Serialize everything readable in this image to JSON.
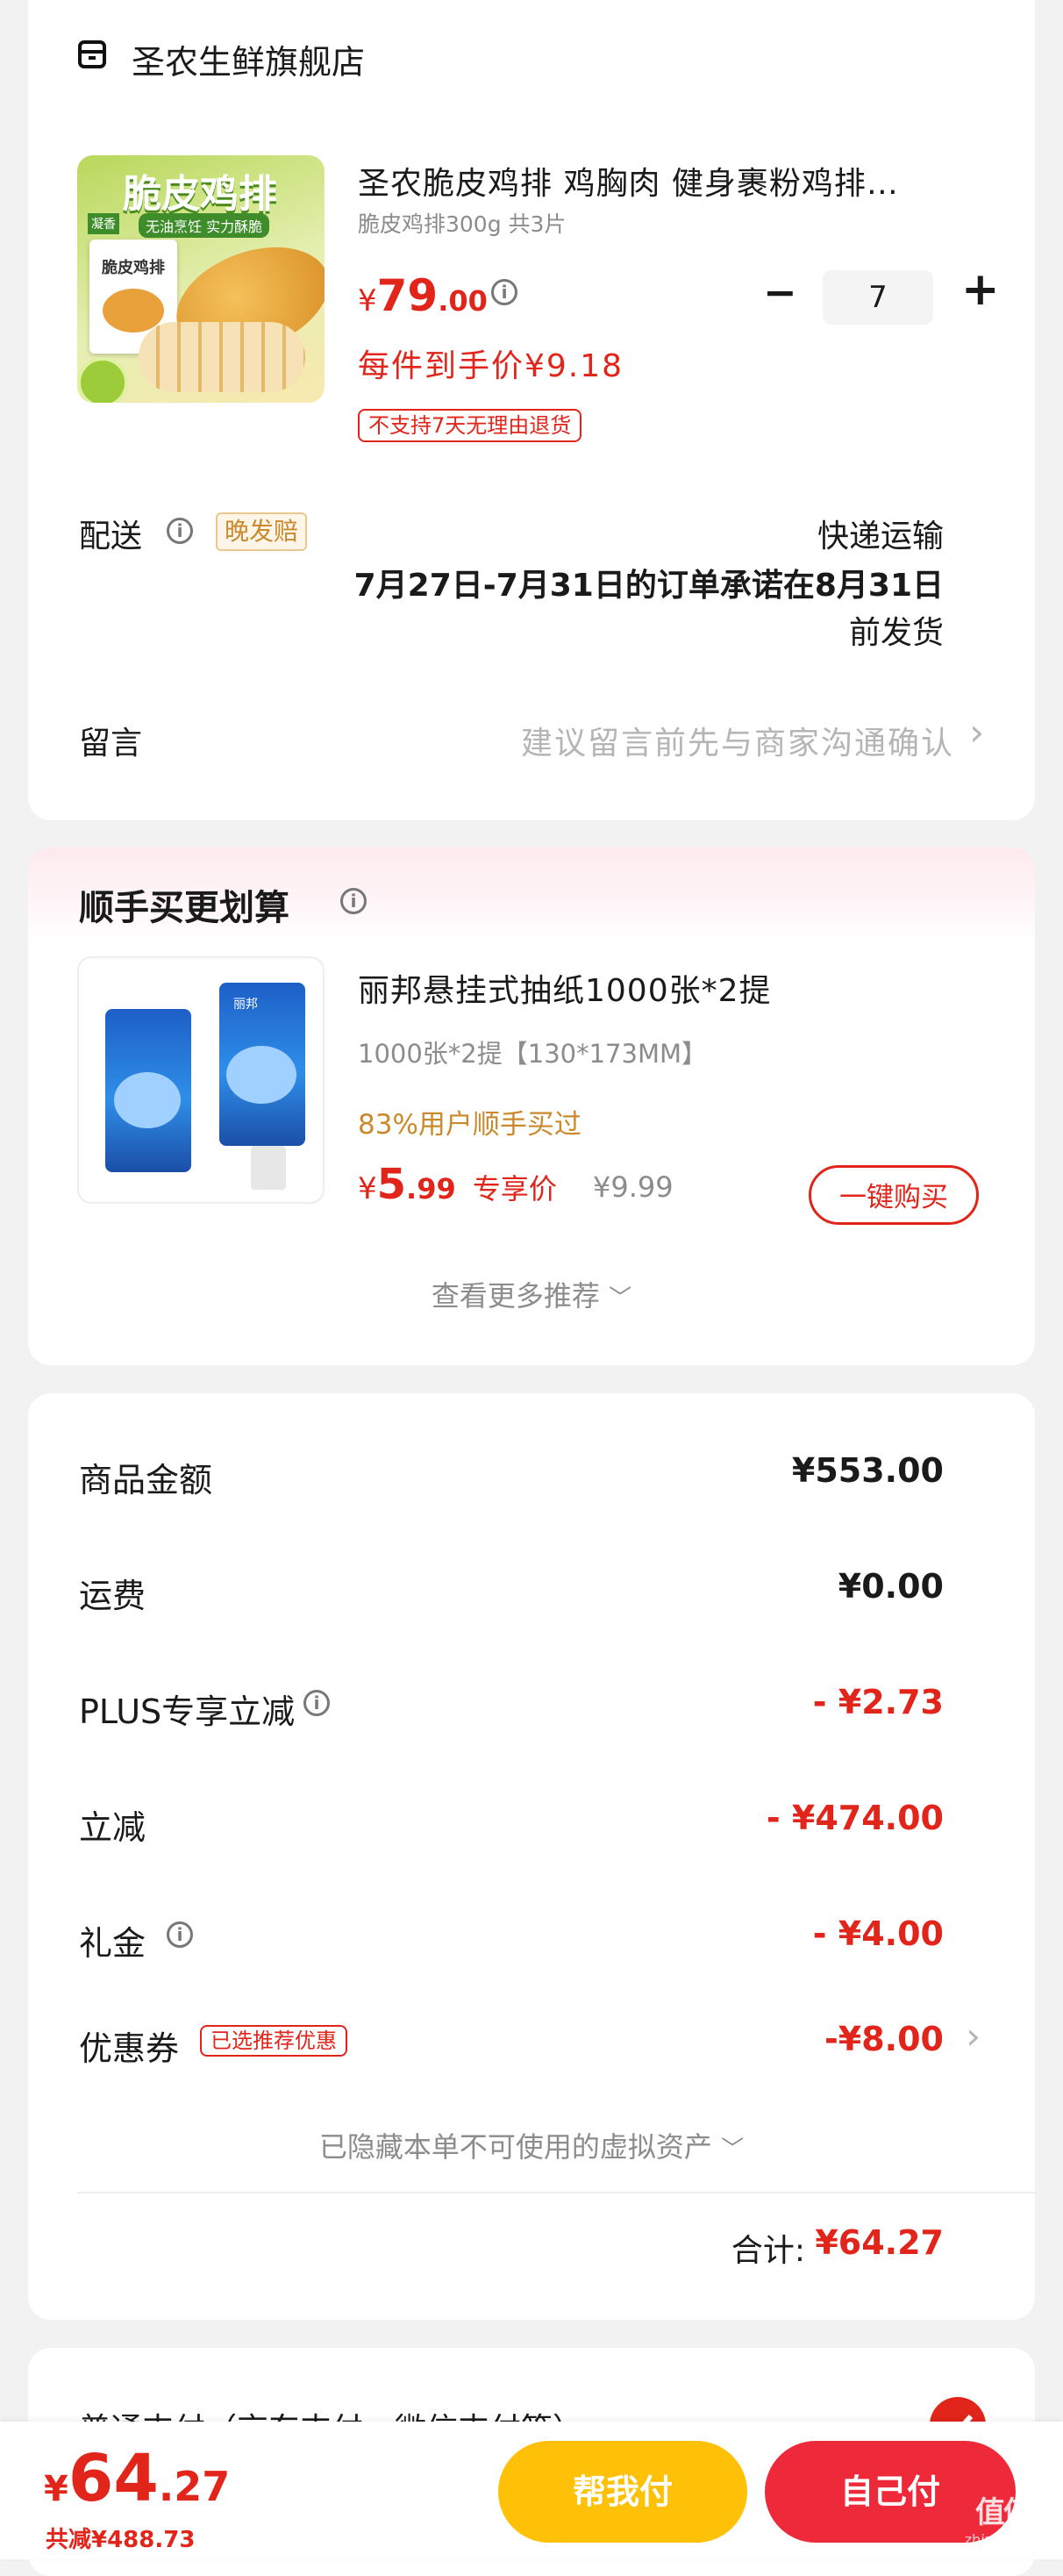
{
  "shop": {
    "icon": "store-icon",
    "name": "圣农生鲜旗舰店"
  },
  "product": {
    "image_icon": "chicken-cutlet-package-image",
    "image_title": "脆皮鸡排",
    "image_subtitle": "无油烹饪 实力酥脆",
    "image_badge": "凝香",
    "image_pack_text": "脆皮鸡排",
    "title": "圣农脆皮鸡排 鸡胸肉 健身裹粉鸡排…",
    "spec": "脆皮鸡排300g 共3片",
    "price_symbol": "¥",
    "price_int": "79",
    "price_dec": ".00",
    "qty": "7",
    "minus": "−",
    "plus": "+",
    "unit_price": "每件到手价¥9.18",
    "return_notice": "不支持7天无理由退货"
  },
  "delivery": {
    "label": "配送",
    "late_tag": "晚发赔",
    "method": "快递运输",
    "promise_line1": "7月27日-7月31日的订单承诺在8月31日",
    "promise_line2": "前发货"
  },
  "message": {
    "label": "留言",
    "placeholder": "建议留言前先与商家沟通确认",
    "arrow": "›"
  },
  "recommend": {
    "title": "顺手买更划算",
    "item_image": "tissue-package-image",
    "item_brand": "丽邦",
    "item_title": "丽邦悬挂式抽纸1000张*2提",
    "item_spec": "1000张*2提【130*173MM】",
    "item_social": "83%用户顺手买过",
    "price_symbol": "¥",
    "price_int": "5",
    "price_dec": ".99",
    "price_tag": "专享价",
    "orig_price": "¥9.99",
    "buy_button": "一键购买",
    "more": "查看更多推荐"
  },
  "summary": {
    "goods_label": "商品金额",
    "goods_value": "¥553.00",
    "shipping_label": "运费",
    "shipping_value": "¥0.00",
    "plus_label": "PLUS专享立减",
    "plus_value": "- ¥2.73",
    "discount_label": "立减",
    "discount_value": "- ¥474.00",
    "gift_label": "礼金",
    "gift_value": "- ¥4.00",
    "coupon_label": "优惠券",
    "coupon_tag": "已选推荐优惠",
    "coupon_value": "-¥8.00",
    "hidden_assets": "已隐藏本单不可使用的虚拟资产",
    "total_label": "合计:",
    "total_value": "¥64.27"
  },
  "payment": {
    "partial_text": "普通支付（京东支付、微信支付等）"
  },
  "bottom_bar": {
    "price_symbol": "¥",
    "price_int": "64",
    "price_dec": ".27",
    "saved": "共减¥488.73",
    "help_pay": "帮我付",
    "self_pay": "自己付"
  },
  "watermark": {
    "text": "值值值",
    "sub": "zhizhizhi.com"
  },
  "colors": {
    "accent": "#e1251b",
    "yellow": "#ffc107",
    "gold": "#c9892c",
    "grey": "#8c8c8c"
  }
}
